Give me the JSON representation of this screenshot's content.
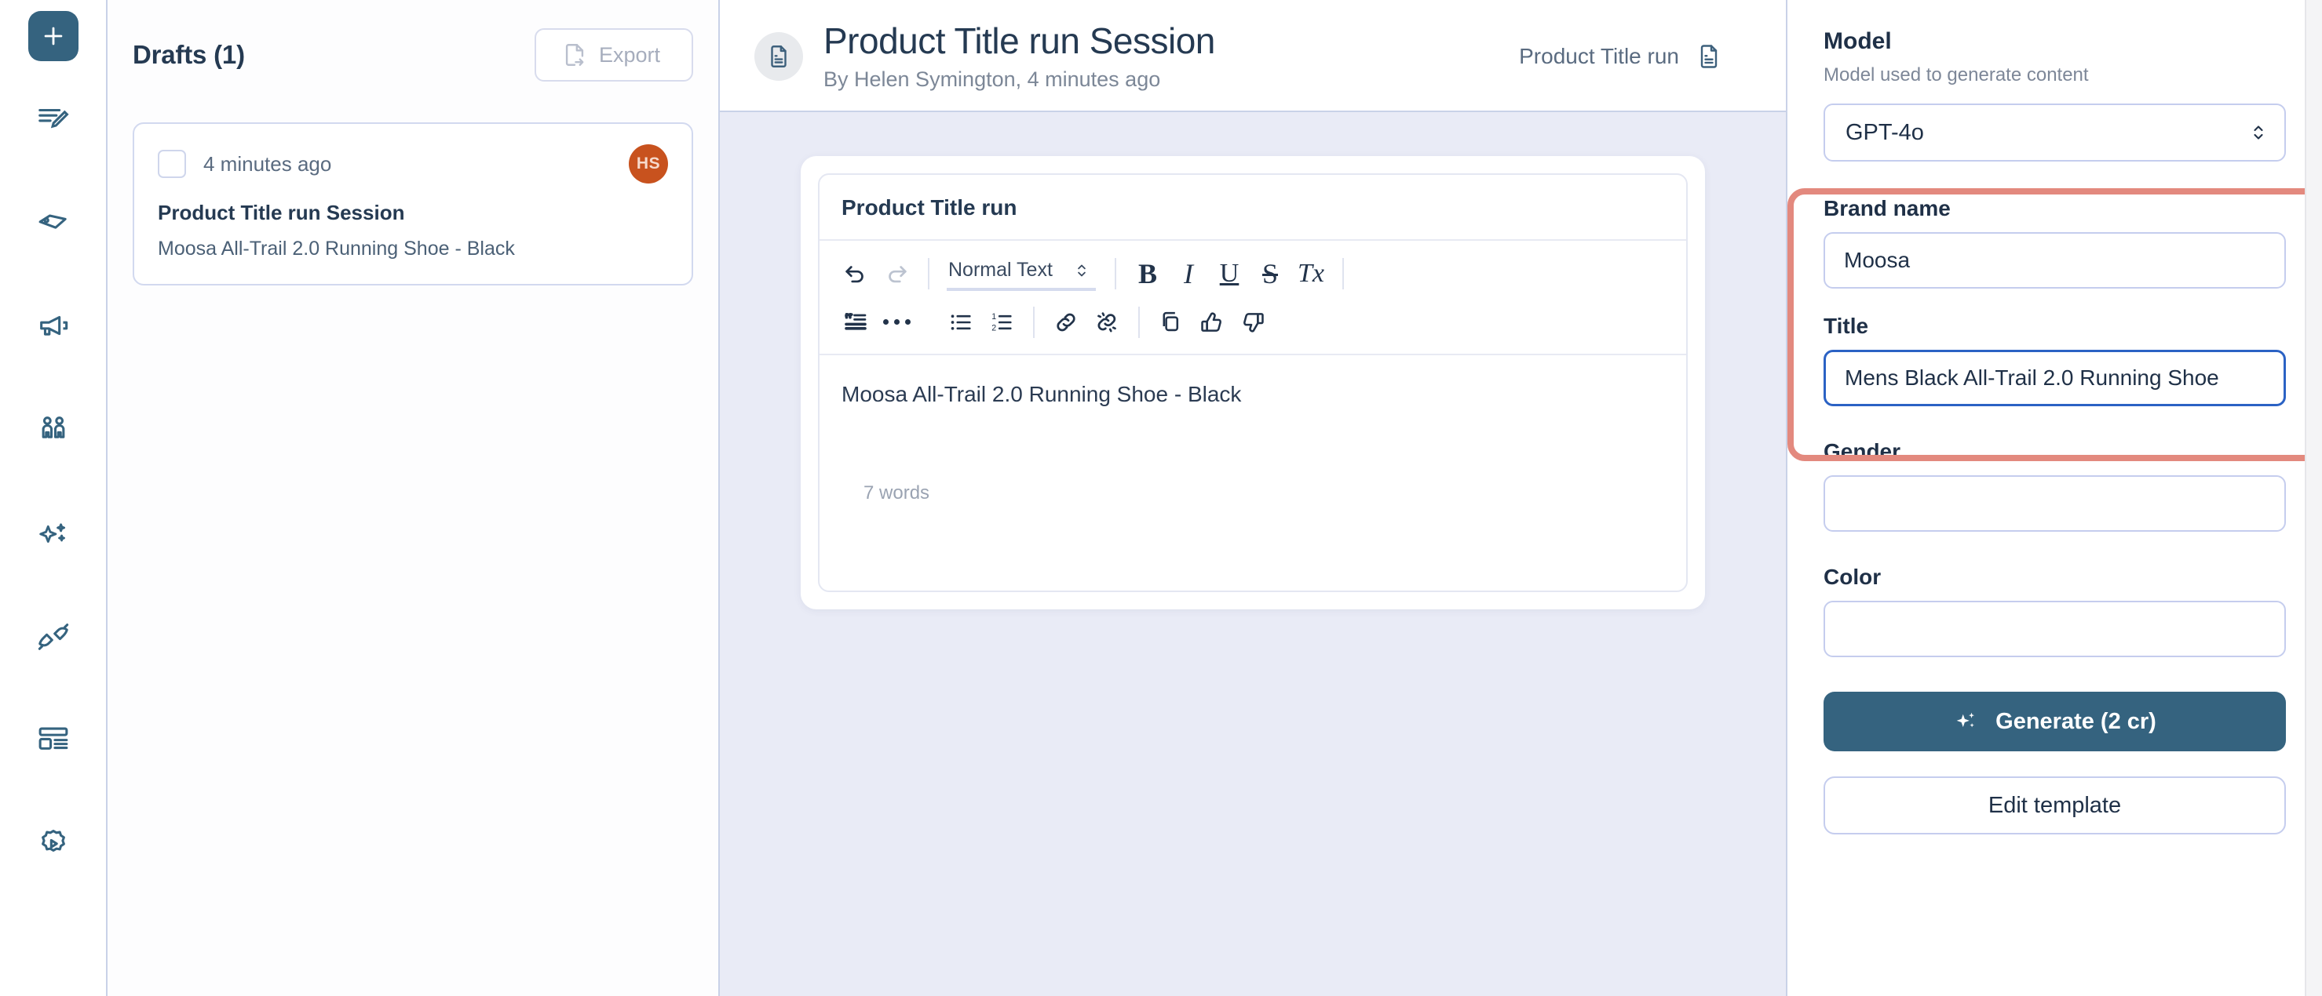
{
  "rail": {
    "add_button": "add-new",
    "items": [
      {
        "icon": "document-edit-icon",
        "name": "sidebar-item-documents"
      },
      {
        "icon": "tag-icon",
        "name": "sidebar-item-tags"
      },
      {
        "icon": "megaphone-icon",
        "name": "sidebar-item-campaigns"
      },
      {
        "icon": "people-icon",
        "name": "sidebar-item-audience"
      },
      {
        "icon": "sparkle-icon",
        "name": "sidebar-item-ai"
      },
      {
        "icon": "plug-icon",
        "name": "sidebar-item-integrations"
      },
      {
        "icon": "layout-icon",
        "name": "sidebar-item-templates"
      },
      {
        "icon": "settings-play-icon",
        "name": "sidebar-item-settings"
      }
    ]
  },
  "drafts": {
    "title": "Drafts (1)",
    "export_label": "Export",
    "export_icon": "file-export-icon",
    "items": [
      {
        "time": "4 minutes ago",
        "avatar_initials": "HS",
        "name": "Product Title run Session",
        "subtitle": "Moosa All-Trail 2.0 Running Shoe - Black"
      }
    ]
  },
  "header": {
    "doc_icon": "file-text-icon",
    "title": "Product Title run Session",
    "byline": "By Helen Symington, 4 minutes ago",
    "run_label": "Product Title run",
    "run_icon": "file-text-icon"
  },
  "editor": {
    "card_title": "Product Title run",
    "block_style": "Normal Text",
    "toolbar_row1": [
      {
        "name": "undo-button",
        "glyph": "undo-icon"
      },
      {
        "name": "redo-button",
        "glyph": "redo-icon"
      }
    ],
    "format_buttons": [
      {
        "name": "bold-button",
        "label": "B"
      },
      {
        "name": "italic-button",
        "label": "I"
      },
      {
        "name": "underline-button",
        "label": "U"
      },
      {
        "name": "strikethrough-button",
        "label": "S"
      },
      {
        "name": "clear-format-button",
        "label": "Tx"
      }
    ],
    "toolbar_row2": [
      {
        "name": "blockquote-button",
        "glyph": "quote-icon"
      },
      {
        "name": "more-button",
        "glyph": "ellipsis-icon"
      },
      {
        "name": "bullet-list-button",
        "glyph": "bullet-list-icon"
      },
      {
        "name": "numbered-list-button",
        "glyph": "numbered-list-icon"
      },
      {
        "name": "link-button",
        "glyph": "link-icon"
      },
      {
        "name": "unlink-button",
        "glyph": "unlink-icon"
      },
      {
        "name": "copy-button",
        "glyph": "copy-icon"
      },
      {
        "name": "thumbs-up-button",
        "glyph": "thumbs-up-icon"
      },
      {
        "name": "thumbs-down-button",
        "glyph": "thumbs-down-icon"
      }
    ],
    "body_text": "Moosa All-Trail 2.0 Running Shoe - Black",
    "word_count": "7 words"
  },
  "panel": {
    "model_heading": "Model",
    "model_description": "Model used to generate content",
    "model_value": "GPT-4o",
    "fields": [
      {
        "label": "Brand name",
        "value": "Moosa",
        "focused": false
      },
      {
        "label": "Title",
        "value": "Mens Black All-Trail 2.0 Running Shoe",
        "focused": true
      },
      {
        "label": "Gender",
        "value": "",
        "focused": false
      },
      {
        "label": "Color",
        "value": "",
        "focused": false
      }
    ],
    "generate_label": "Generate (2 cr)",
    "generate_icon": "sparkle-icon",
    "edit_template_label": "Edit template"
  },
  "colors": {
    "brand_blue": "#35637f",
    "avatar_orange": "#c8521e",
    "highlight_red": "#e3897e",
    "canvas_lavender": "#e9ebf6",
    "border_blue": "#c5cdee",
    "focus_blue": "#2b62c4"
  }
}
